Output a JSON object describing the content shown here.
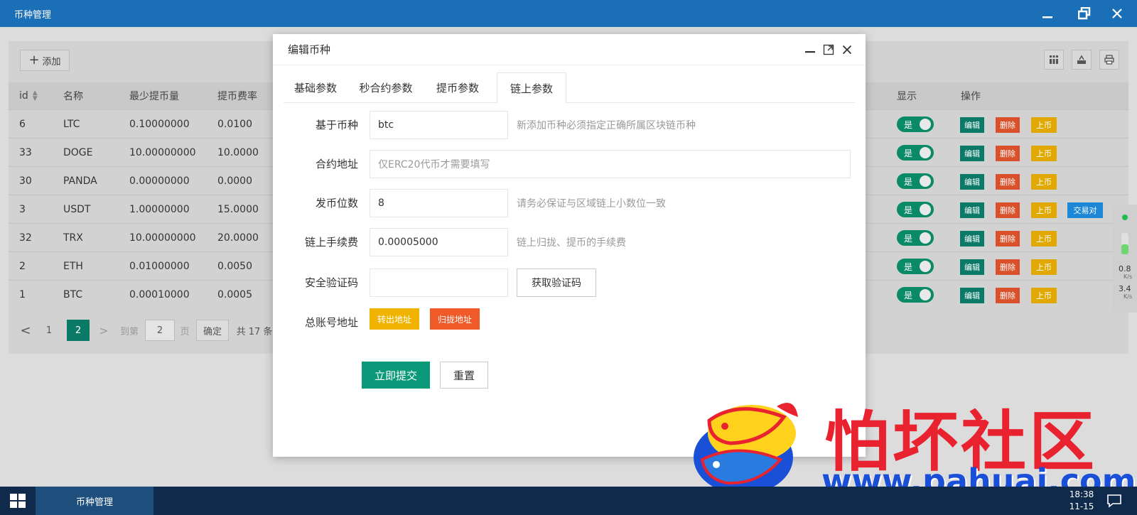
{
  "window": {
    "title": "币种管理",
    "minimize_icon": "minimize-icon",
    "restore_icon": "restore-icon",
    "close_icon": "close-icon"
  },
  "toolbar": {
    "add_label": "添加",
    "icons": [
      "columns-icon",
      "export-icon",
      "print-icon"
    ]
  },
  "table": {
    "headers": {
      "id": "id",
      "name": "名称",
      "min_withdraw": "最少提币量",
      "fee_rate": "提币费率",
      "display": "显示",
      "actions": "操作"
    },
    "rows": [
      {
        "id": "6",
        "name": "LTC",
        "min": "0.10000000",
        "fee": "0.0100",
        "show": "是",
        "pair": false
      },
      {
        "id": "33",
        "name": "DOGE",
        "min": "10.00000000",
        "fee": "10.0000",
        "show": "是",
        "pair": false
      },
      {
        "id": "30",
        "name": "PANDA",
        "min": "0.00000000",
        "fee": "0.0000",
        "show": "是",
        "pair": false
      },
      {
        "id": "3",
        "name": "USDT",
        "min": "1.00000000",
        "fee": "15.0000",
        "show": "是",
        "pair": true
      },
      {
        "id": "32",
        "name": "TRX",
        "min": "10.00000000",
        "fee": "20.0000",
        "show": "是",
        "pair": false
      },
      {
        "id": "2",
        "name": "ETH",
        "min": "0.01000000",
        "fee": "0.0050",
        "show": "是",
        "pair": false
      },
      {
        "id": "1",
        "name": "BTC",
        "min": "0.00010000",
        "fee": "0.0005",
        "show": "是",
        "pair": false
      }
    ],
    "action_labels": {
      "edit": "编辑",
      "delete": "删除",
      "list": "上币",
      "pair": "交易对"
    }
  },
  "pager": {
    "prev": "<",
    "pages": [
      "1",
      "2"
    ],
    "current": "2",
    "next": ">",
    "goto_label": "到第",
    "goto_value": "2",
    "page_unit": "页",
    "confirm": "确定",
    "total": "共 17 条"
  },
  "dialog": {
    "title": "编辑币种",
    "tabs": [
      "基础参数",
      "秒合约参数",
      "提币参数",
      "链上参数"
    ],
    "active_tab": "链上参数",
    "fields": {
      "base_coin": {
        "label": "基于币种",
        "value": "btc",
        "hint": "新添加币种必须指定正确所属区块链币种"
      },
      "contract": {
        "label": "合约地址",
        "value": "",
        "placeholder": "仅ERC20代币才需要填写"
      },
      "decimals": {
        "label": "发币位数",
        "value": "8",
        "hint": "请务必保证与区域链上小数位一致"
      },
      "chain_fee": {
        "label": "链上手续费",
        "value": "0.00005000",
        "hint": "链上归拢、提币的手续费"
      },
      "security_code": {
        "label": "安全验证码",
        "value": "",
        "button": "获取验证码"
      },
      "main_account": {
        "label": "总账号地址",
        "transfer_out": "转出地址",
        "collect": "归拢地址"
      }
    },
    "submit": "立即提交",
    "reset": "重置"
  },
  "watermark": {
    "brand": "怕坏社区",
    "url": "www.pahuai.com"
  },
  "net_widget": {
    "up_value": "0.8",
    "up_unit": "K/s",
    "down_value": "3.4",
    "down_unit": "K/s"
  },
  "taskbar": {
    "task_label": "币种管理",
    "time": "18:38",
    "date": "11-15"
  }
}
